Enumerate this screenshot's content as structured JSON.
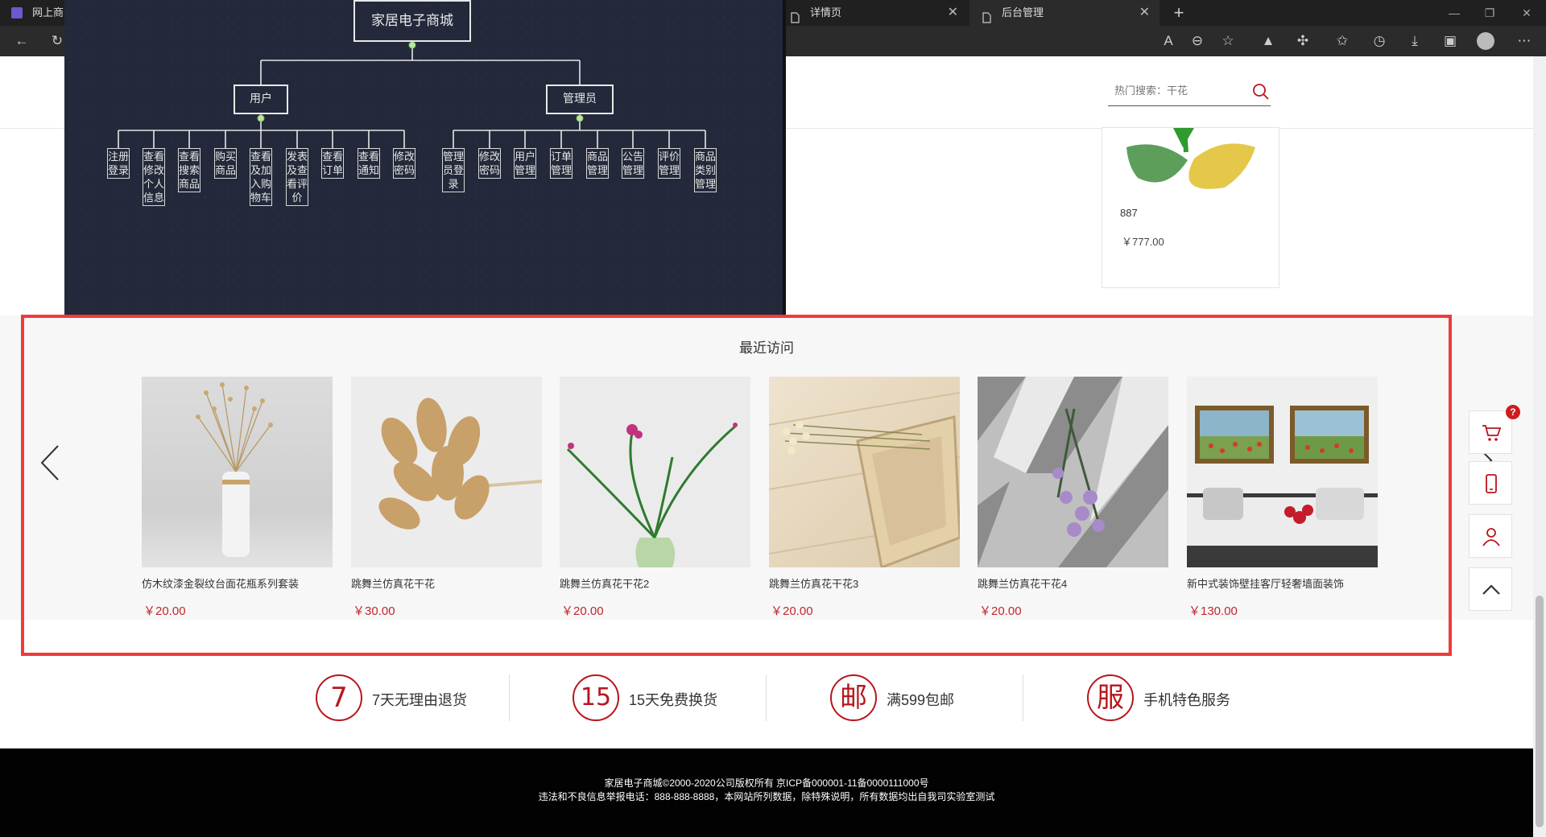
{
  "browser": {
    "tabs": [
      {
        "title": "网上商",
        "active": false
      },
      {
        "title": "详情页",
        "active": false
      },
      {
        "title": "后台管理",
        "active": true
      }
    ],
    "new_tab_icon": "plus-icon",
    "window_controls": {
      "minimize": "—",
      "restore": "❐",
      "close": "✕"
    }
  },
  "header": {
    "search": {
      "placeholder": "热门搜索：干花",
      "icon": "search-icon"
    }
  },
  "product_card": {
    "name": "887",
    "price": "￥777.00"
  },
  "diagram": {
    "root": "家居电子商城",
    "branches": [
      {
        "label": "用户",
        "leaves": [
          "注册登录",
          "查看修改个人信息",
          "查看搜索商品",
          "购买商品",
          "查看及加入购物车",
          "发表及查看评价",
          "查看订单",
          "查看通知",
          "修改密码"
        ]
      },
      {
        "label": "管理员",
        "leaves": [
          "管理员登录",
          "修改密码",
          "用户管理",
          "订单管理",
          "商品管理",
          "公告管理",
          "评价管理",
          "商品类别管理"
        ]
      }
    ]
  },
  "recent": {
    "title": "最近访问",
    "items": [
      {
        "name": "仿木纹漆金裂纹台面花瓶系列套装",
        "price": "￥20.00"
      },
      {
        "name": "跳舞兰仿真花干花",
        "price": "￥30.00"
      },
      {
        "name": "跳舞兰仿真花干花2",
        "price": "￥20.00"
      },
      {
        "name": "跳舞兰仿真花干花3",
        "price": "￥20.00"
      },
      {
        "name": "跳舞兰仿真花干花4",
        "price": "￥20.00"
      },
      {
        "name": "新中式装饰壁挂客厅轻奢墙面装饰",
        "price": "￥130.00"
      }
    ]
  },
  "side_toolbar": {
    "cart_badge": "?",
    "buttons": [
      "cart-icon",
      "phone-icon",
      "user-icon",
      "back-to-top-icon"
    ]
  },
  "promises": [
    {
      "glyph": "7",
      "text": "7天无理由退货"
    },
    {
      "glyph": "15",
      "text": "15天免费换货"
    },
    {
      "glyph": "邮",
      "text": "满599包邮"
    },
    {
      "glyph": "服",
      "text": "手机特色服务"
    }
  ],
  "footer": {
    "line1": "家居电子商城©2000-2020公司版权所有 京ICP备000001-11备0000111000号",
    "line2": "违法和不良信息举报电话：888-888-8888，本网站所列数据，除特殊说明，所有数据均出自我司实验室测试"
  },
  "colors": {
    "accent": "#b8161c",
    "price": "#c1272d",
    "highlight": "#ef3b3b",
    "diagram_bg": "#23293a",
    "footer_bg": "#020202"
  }
}
